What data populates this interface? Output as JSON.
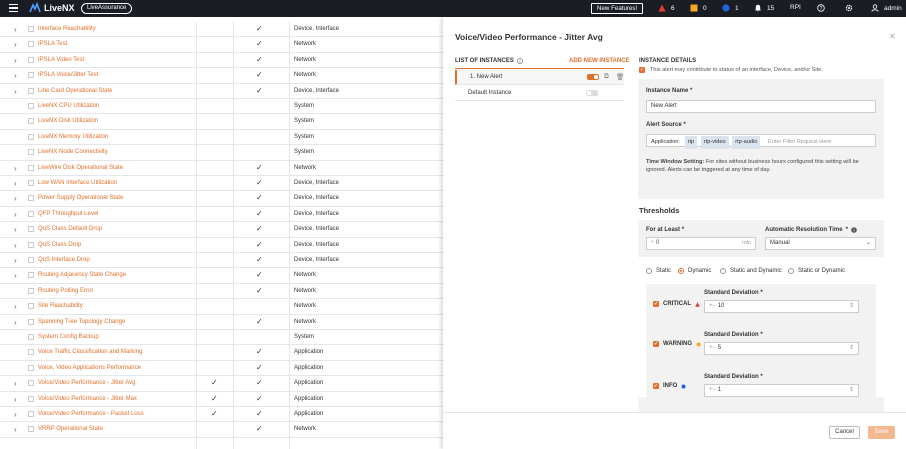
{
  "topbar": {
    "app_name": "LiveNX",
    "pill_label": "LiveAssurance",
    "new_features_label": "New Features!",
    "critical_count": "6",
    "warning_count": "0",
    "info_count": "1",
    "notifications_count": "15",
    "rpi_label": "RPI",
    "user_label": "admin",
    "colors": {
      "critical": "#e53935",
      "warning": "#f9a825",
      "info": "#1e63d8",
      "bar": "#1b1d24",
      "accent": "#e2702b"
    }
  },
  "table": {
    "rows": [
      {
        "name": "Interface Reachability",
        "expand": true,
        "chk1": "",
        "chk2": "✓",
        "type": "Device, Interface"
      },
      {
        "name": "IPSLA Test",
        "expand": true,
        "chk1": "",
        "chk2": "✓",
        "type": "Network"
      },
      {
        "name": "IPSLA Video Test",
        "expand": true,
        "chk1": "",
        "chk2": "✓",
        "type": "Network"
      },
      {
        "name": "IPSLA Voice/Jitter Test",
        "expand": true,
        "chk1": "",
        "chk2": "✓",
        "type": "Network"
      },
      {
        "name": "Line Card Operational State",
        "expand": true,
        "chk1": "",
        "chk2": "✓",
        "type": "Device, Interface"
      },
      {
        "name": "LiveNX CPU Utilization",
        "expand": false,
        "chk1": "",
        "chk2": "",
        "type": "System"
      },
      {
        "name": "LiveNX Disk Utilization",
        "expand": false,
        "chk1": "",
        "chk2": "",
        "type": "System"
      },
      {
        "name": "LiveNX Memory Utilization",
        "expand": false,
        "chk1": "",
        "chk2": "",
        "type": "System"
      },
      {
        "name": "LiveNX Node Connectivity",
        "expand": false,
        "chk1": "",
        "chk2": "",
        "type": "System"
      },
      {
        "name": "LiveWire Disk Operational State",
        "expand": true,
        "chk1": "",
        "chk2": "✓",
        "type": "Network"
      },
      {
        "name": "Low WAN Interface Utilization",
        "expand": true,
        "chk1": "",
        "chk2": "✓",
        "type": "Device, Interface"
      },
      {
        "name": "Power Supply Operational State",
        "expand": true,
        "chk1": "",
        "chk2": "✓",
        "type": "Device, Interface"
      },
      {
        "name": "QFP Throughput Level",
        "expand": true,
        "chk1": "",
        "chk2": "✓",
        "type": "Device, Interface"
      },
      {
        "name": "QoS Class Default Drop",
        "expand": true,
        "chk1": "",
        "chk2": "✓",
        "type": "Device, Interface"
      },
      {
        "name": "QoS Class Drop",
        "expand": true,
        "chk1": "",
        "chk2": "✓",
        "type": "Device, Interface"
      },
      {
        "name": "QoS Interface Drop",
        "expand": true,
        "chk1": "",
        "chk2": "✓",
        "type": "Device, Interface"
      },
      {
        "name": "Routing Adjacency State Change",
        "expand": true,
        "chk1": "",
        "chk2": "✓",
        "type": "Network"
      },
      {
        "name": "Routing Polling Error",
        "expand": false,
        "chk1": "",
        "chk2": "✓",
        "type": "Network"
      },
      {
        "name": "Site Reachability",
        "expand": true,
        "chk1": "",
        "chk2": "",
        "type": "Network"
      },
      {
        "name": "Spanning Tree Topology Change",
        "expand": true,
        "chk1": "",
        "chk2": "✓",
        "type": "Network"
      },
      {
        "name": "System Config Backup",
        "expand": false,
        "chk1": "",
        "chk2": "",
        "type": "System"
      },
      {
        "name": "Voice Traffic Classification and Marking",
        "expand": false,
        "chk1": "",
        "chk2": "✓",
        "type": "Application"
      },
      {
        "name": "Voice, Video Applications Performance",
        "expand": false,
        "chk1": "",
        "chk2": "✓",
        "type": "Application"
      },
      {
        "name": "Voice/Video Performance - Jitter Avg",
        "expand": true,
        "chk1": "✓",
        "chk2": "✓",
        "type": "Application"
      },
      {
        "name": "Voice/Video Performance - Jitter Max",
        "expand": true,
        "chk1": "✓",
        "chk2": "✓",
        "type": "Application"
      },
      {
        "name": "Voice/Video Performance - Packet Loss",
        "expand": true,
        "chk1": "✓",
        "chk2": "✓",
        "type": "Application"
      },
      {
        "name": "VRRP Operational State",
        "expand": true,
        "chk1": "",
        "chk2": "✓",
        "type": "Network"
      }
    ]
  },
  "panel": {
    "title": "Voice/Video Performance - Jitter Avg",
    "list_header": "LIST OF INSTANCES",
    "add_instance": "ADD NEW INSTANCE",
    "instances": [
      {
        "label": "1. New Alert",
        "enabled": true,
        "selected": true
      },
      {
        "label": "Default Instance",
        "enabled": false,
        "selected": false
      }
    ],
    "details": {
      "header": "INSTANCE DETAILS",
      "contributes_text": "This alert may contribute to status of an interface, Device, and/or Site.",
      "instance_name_label": "Instance Name",
      "instance_name_value": "New Alert",
      "alert_source_label": "Alert Source",
      "application_prefix": "Application:",
      "source_tags": [
        "rtp",
        "rtp-video",
        "rtp-audio"
      ],
      "filter_placeholder": "Enter Filter Request Here",
      "time_window_bold": "Time Window Setting:",
      "time_window_text": "For sites without business hours configured this setting will be ignored. Alerts can be triggered at any time of day.",
      "thresholds_header": "Thresholds",
      "for_at_least_label": "For at Least",
      "for_at_least_value": "0",
      "for_at_least_unit": "min",
      "resolution_label": "Automatic Resolution Time",
      "resolution_value": "Manual",
      "mode_options": [
        "Static",
        "Dynamic",
        "Static and Dynamic",
        "Static or Dynamic"
      ],
      "mode_selected": "Dynamic",
      "severities": [
        {
          "name": "CRITICAL",
          "std_label": "Standard Deviation",
          "value": "10",
          "icon": "triangle"
        },
        {
          "name": "WARNING",
          "std_label": "Standard Deviation",
          "value": "5",
          "icon": "circle-yellow"
        },
        {
          "name": "INFO",
          "std_label": "Standard Deviation",
          "value": "1",
          "icon": "circle-blue"
        }
      ],
      "required_mark": "*"
    },
    "footer": {
      "cancel_label": "Cancel",
      "save_label": "Save"
    }
  }
}
